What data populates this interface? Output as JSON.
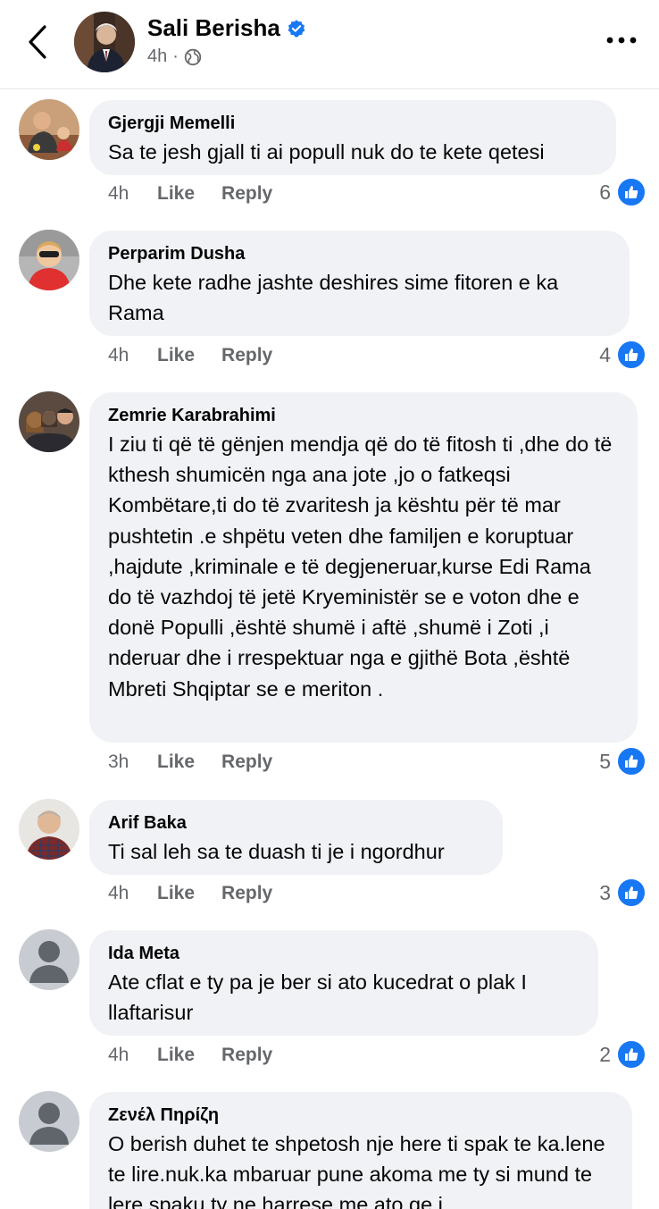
{
  "header": {
    "name": "Sali Berisha",
    "time": "4h",
    "dot": "·",
    "back_icon": "chevron-left-icon",
    "more_icon": "more-horizontal-icon",
    "verified_icon": "verified-badge-icon",
    "privacy_icon": "globe-icon"
  },
  "colors": {
    "accent": "#1877f2",
    "bubble": "#f0f2f5",
    "muted": "#65676b",
    "text": "#050505"
  },
  "actions": {
    "like_label": "Like",
    "reply_label": "Reply"
  },
  "comments": [
    {
      "author": "Gjergji Memelli",
      "text": "Sa te jesh gjall ti ai popull nuk do te kete qetesi",
      "time": "4h",
      "reactions": "6"
    },
    {
      "author": "Perparim Dusha",
      "text": "Dhe kete radhe jashte deshires sime fitoren e ka Rama",
      "time": "4h",
      "reactions": "4"
    },
    {
      "author": "Zemrie Karabrahimi",
      "text": "I ziu ti që të gënjen mendja që do të fitosh ti ,dhe do të kthesh shumicën nga ana jote ,jo o fatkeqsi Kombëtare,ti do të zvaritesh ja kështu për të mar pushtetin .e shpëtu veten dhe familjen e koruptuar ,hajdute ,kriminale e të degjeneruar,kurse Edi Rama do të vazhdoj të jetë Kryeministër se e voton dhe e donë Populli ,është shumë i aftë ,shumë i Zoti ,i nderuar dhe i rrespektuar nga e gjithë Bota ,është Mbreti Shqiptar se e meriton .",
      "time": "3h",
      "reactions": "5"
    },
    {
      "author": "Arif Baka",
      "text": "Ti sal leh sa te duash ti je i ngordhur",
      "time": "4h",
      "reactions": "3"
    },
    {
      "author": "Ida Meta",
      "text": "Ate cflat e ty pa je ber si ato kucedrat o plak I llaftarisur",
      "time": "4h",
      "reactions": "2"
    },
    {
      "author": "Ζενέλ Πηρίζη",
      "text": "O berish duhet te shpetosh nje here ti spak te ka.lene te lire.nuk.ka mbaruar pune akoma me ty si mund te lere spaku ty ne harrese me ato qe i"
    }
  ]
}
